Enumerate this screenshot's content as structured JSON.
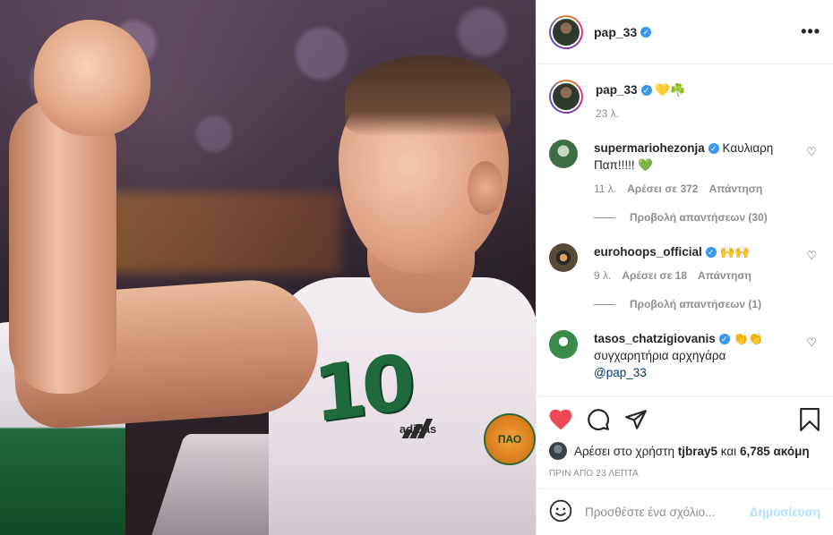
{
  "photo": {
    "jersey_number": "10",
    "brand": "adidas",
    "crest_text": "ΠΑΟ"
  },
  "header": {
    "username": "pap_33",
    "more_label": "•••"
  },
  "caption": {
    "username": "pap_33",
    "text": "💛☘️",
    "time": "23 λ."
  },
  "comments": [
    {
      "username": "supermariohezonja",
      "text": "Καυλιαρη Παπ!!!!! 💚",
      "time": "11 λ.",
      "likes": "Αρέσει σε 372",
      "reply": "Απάντηση",
      "view_replies": "Προβολή απαντήσεων (30)"
    },
    {
      "username": "eurohoops_official",
      "text": "🙌🙌",
      "time": "9 λ.",
      "likes": "Αρέσει σε 18",
      "reply": "Απάντηση",
      "view_replies": "Προβολή απαντήσεων (1)"
    },
    {
      "username": "tasos_chatzigiovanis",
      "text": "👏👏 συγχαρητήρια αρχηγάρα",
      "mention": "@pap_33"
    }
  ],
  "likes": {
    "prefix": "Αρέσει στο χρήστη",
    "user": "tjbray5",
    "middle": "και",
    "count": "6,785 ακόμη"
  },
  "timestamp": "ΠΡΙΝ ΑΠΟ 23 ΛΕΠΤΑ",
  "add_comment": {
    "placeholder": "Προσθέστε ένα σχόλιο...",
    "post_label": "Δημοσίευση"
  },
  "colors": {
    "verified": "#3897f0",
    "like_red": "#ed4956",
    "post_disabled": "#b2dffc"
  }
}
